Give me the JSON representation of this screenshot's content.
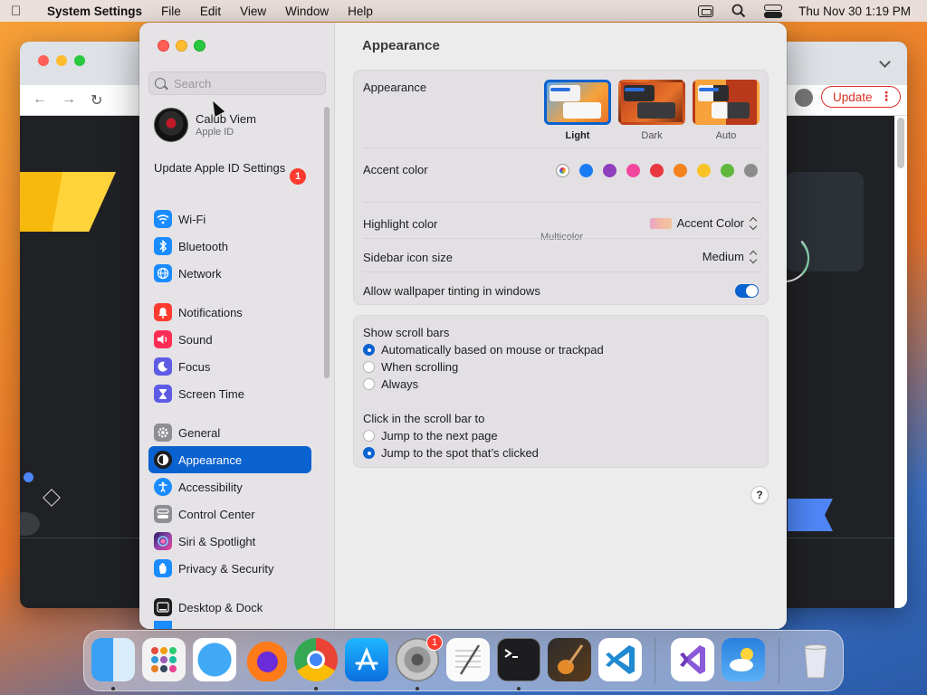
{
  "menubar": {
    "app_name": "System Settings",
    "menus": [
      "File",
      "Edit",
      "View",
      "Window",
      "Help"
    ],
    "clock": "Thu Nov 30  1:19 PM"
  },
  "background_window": {
    "update_label": "Update"
  },
  "sidebar": {
    "search_placeholder": "Search",
    "account": {
      "name": "Calub Viem",
      "subtitle": "Apple ID"
    },
    "update_label": "Update Apple ID Settings",
    "update_badge": "1",
    "items": [
      {
        "label": "Wi-Fi",
        "icon": "wifi-icon",
        "color": "#1a8cff"
      },
      {
        "label": "Bluetooth",
        "icon": "bluetooth-icon",
        "color": "#1a8cff"
      },
      {
        "label": "Network",
        "icon": "globe-icon",
        "color": "#1a8cff"
      },
      {
        "label": "Notifications",
        "icon": "bell-icon",
        "color": "#ff3b30"
      },
      {
        "label": "Sound",
        "icon": "speaker-icon",
        "color": "#ff2d55"
      },
      {
        "label": "Focus",
        "icon": "moon-icon",
        "color": "#5e5ce6"
      },
      {
        "label": "Screen Time",
        "icon": "hourglass-icon",
        "color": "#5e5ce6"
      },
      {
        "label": "General",
        "icon": "gear-icon",
        "color": "#8e8e93"
      },
      {
        "label": "Appearance",
        "icon": "appearance-icon",
        "color": "#1d1d1f"
      },
      {
        "label": "Accessibility",
        "icon": "accessibility-icon",
        "color": "#1a8cff"
      },
      {
        "label": "Control Center",
        "icon": "control-center-icon",
        "color": "#8e8e93"
      },
      {
        "label": "Siri & Spotlight",
        "icon": "siri-icon",
        "color": "#8e44ad"
      },
      {
        "label": "Privacy & Security",
        "icon": "hand-icon",
        "color": "#1a8cff"
      },
      {
        "label": "Desktop & Dock",
        "icon": "dock-icon",
        "color": "#1d1d1f"
      }
    ],
    "selected": "Appearance"
  },
  "main": {
    "title": "Appearance",
    "appearance": {
      "label": "Appearance",
      "options": [
        {
          "label": "Light",
          "selected": true
        },
        {
          "label": "Dark",
          "selected": false
        },
        {
          "label": "Auto",
          "selected": false
        }
      ]
    },
    "accent": {
      "label": "Accent color",
      "caption": "Multicolor",
      "colors": [
        "multicolor",
        "#1a7cf5",
        "#8e3fbd",
        "#f2479e",
        "#e8373f",
        "#f5821f",
        "#f7c325",
        "#5fb83b",
        "#8c8c8c"
      ]
    },
    "highlight": {
      "label": "Highlight color",
      "value": "Accent Color"
    },
    "icon_size": {
      "label": "Sidebar icon size",
      "value": "Medium"
    },
    "wallpaper_tinting": {
      "label": "Allow wallpaper tinting in windows",
      "on": true
    },
    "scroll_bars": {
      "label": "Show scroll bars",
      "options": [
        {
          "label": "Automatically based on mouse or trackpad",
          "selected": true
        },
        {
          "label": "When scrolling",
          "selected": false
        },
        {
          "label": "Always",
          "selected": false
        }
      ]
    },
    "click_scroll": {
      "label": "Click in the scroll bar to",
      "options": [
        {
          "label": "Jump to the next page",
          "selected": false
        },
        {
          "label": "Jump to the spot that’s clicked",
          "selected": true
        }
      ]
    },
    "help_label": "?"
  },
  "dock": {
    "apps": [
      "Finder",
      "Launchpad",
      "Safari",
      "Firefox",
      "Chrome",
      "App Store",
      "System Settings",
      "TextEdit",
      "Terminal",
      "GarageBand",
      "Visual Studio Code",
      "Visual Studio",
      "Weather",
      "Trash"
    ],
    "settings_badge": "1"
  }
}
